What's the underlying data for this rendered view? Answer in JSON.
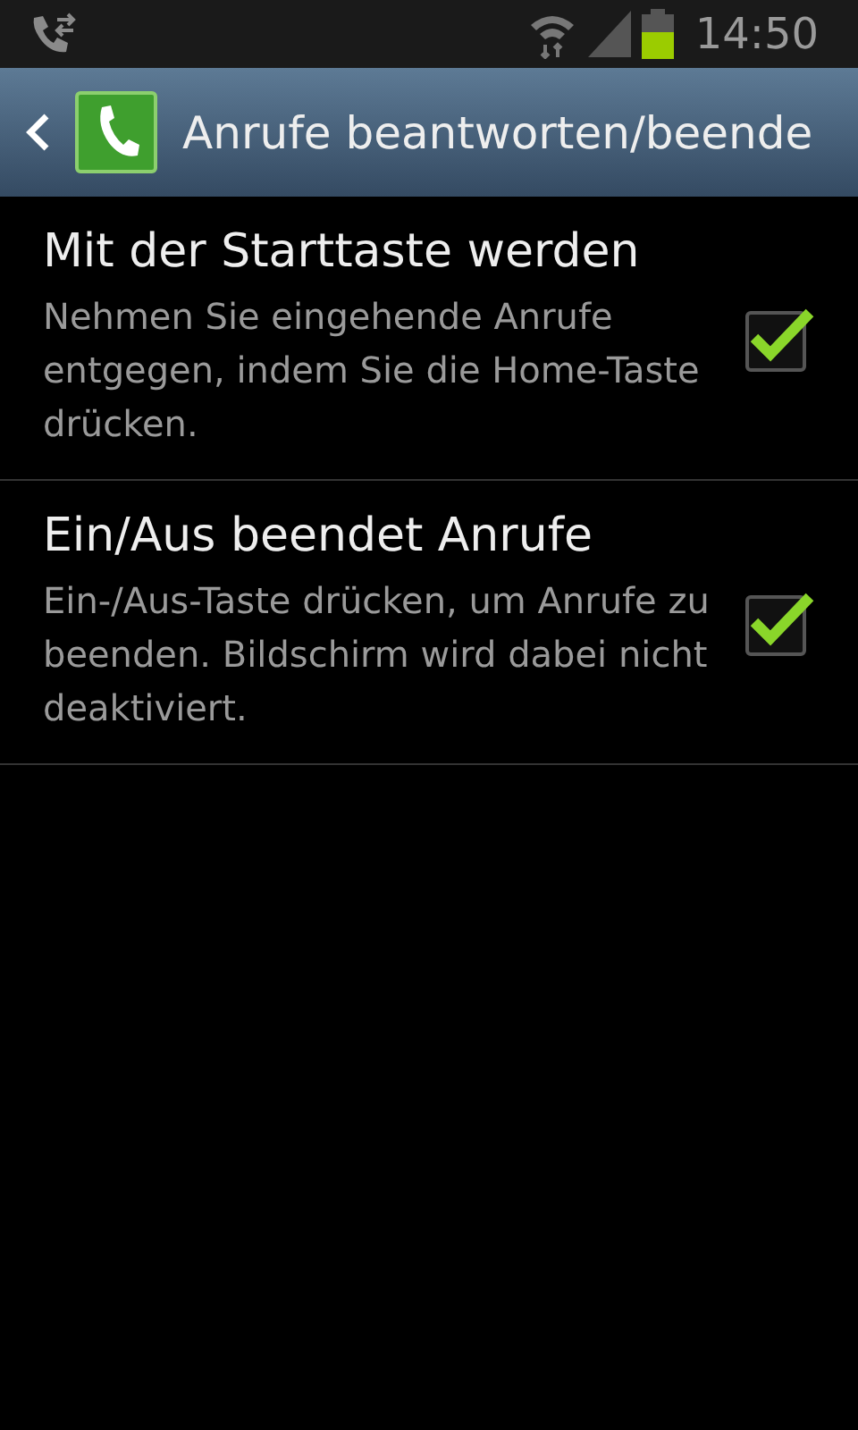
{
  "status_bar": {
    "time": "14:50"
  },
  "action_bar": {
    "title": "Anrufe beantworten/beende"
  },
  "settings": [
    {
      "title": "Mit der Starttaste werden",
      "summary": "Nehmen Sie eingehende Anrufe entgegen, indem Sie die Home-Taste drücken.",
      "checked": true
    },
    {
      "title": "Ein/Aus beendet Anrufe",
      "summary": "Ein-/Aus-Taste drücken, um Anrufe zu beenden. Bildschirm wird dabei nicht deaktiviert.",
      "checked": true
    }
  ]
}
